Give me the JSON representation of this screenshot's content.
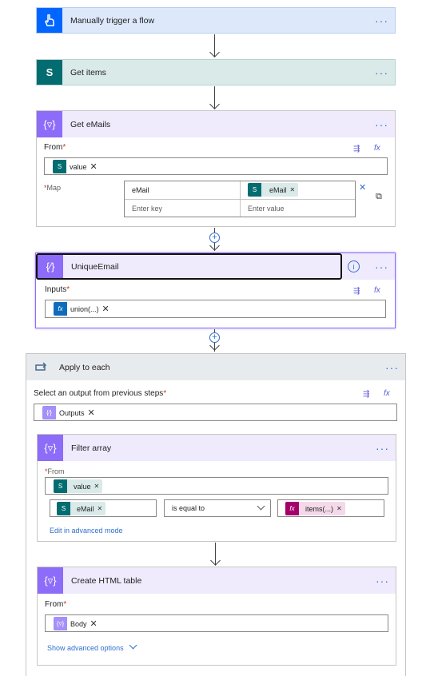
{
  "steps": {
    "trigger": {
      "title": "Manually trigger a flow",
      "icon": "touch-icon",
      "color": "#0066ff"
    },
    "get_items": {
      "title": "Get items",
      "icon": "sharepoint-icon",
      "color": "#036c70"
    },
    "get_emails": {
      "title": "Get eMails",
      "from_label": "From",
      "from_token": "value",
      "map_label": "Map",
      "map_key": "eMail",
      "map_value_token": "eMail",
      "key_placeholder": "Enter key",
      "value_placeholder": "Enter value"
    },
    "unique_email": {
      "title": "UniqueEmail",
      "inputs_label": "Inputs",
      "inputs_token": "union(...)"
    },
    "apply_each": {
      "title": "Apply to each",
      "select_label": "Select an output from previous steps",
      "outputs_token": "Outputs"
    },
    "filter_array": {
      "title": "Filter array",
      "from_label": "From",
      "from_token": "value",
      "left_token": "eMail",
      "operator": "is equal to",
      "right_token": "items(...)",
      "advanced_link": "Edit in advanced mode"
    },
    "create_html": {
      "title": "Create HTML table",
      "from_label": "From",
      "from_token": "Body",
      "advanced_link": "Show advanced options"
    }
  },
  "common": {
    "more": "···",
    "required": "*",
    "plus": "+",
    "close": "✕",
    "fx": "fx"
  },
  "colors": {
    "data_op": "#8c6cf8",
    "data_op_light": "#efebfd",
    "sharepoint": "#036c70",
    "expr": "#0f6cbd",
    "expr_pink": "#a4006b",
    "accent": "#2f6fcf"
  }
}
